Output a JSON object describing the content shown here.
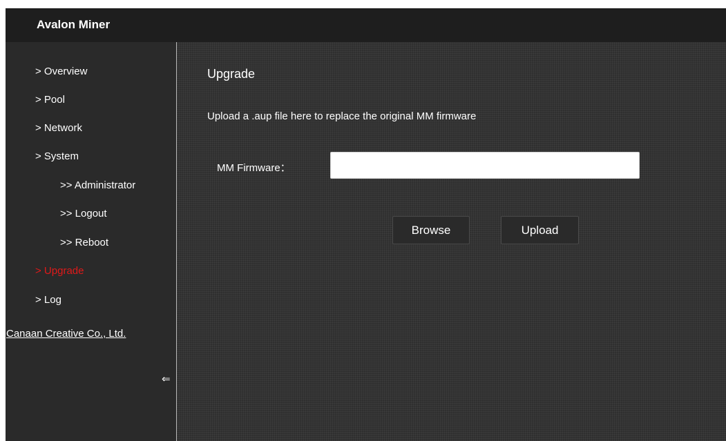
{
  "header": {
    "title": "Avalon Miner"
  },
  "sidebar": {
    "items": [
      {
        "label": "> Overview"
      },
      {
        "label": "> Pool"
      },
      {
        "label": "> Network"
      },
      {
        "label": "> System"
      },
      {
        "label": ">> Administrator"
      },
      {
        "label": ">> Logout"
      },
      {
        "label": ">> Reboot"
      },
      {
        "label": "> Upgrade",
        "active": true
      },
      {
        "label": "> Log"
      }
    ],
    "company_link": "Canaan Creative Co., Ltd.",
    "collapse_icon": "⇐"
  },
  "main": {
    "title": "Upgrade",
    "description": "Upload a .aup file here to replace the original MM firmware",
    "firmware_label": "MM Firmware：",
    "firmware_value": "",
    "browse_label": "Browse",
    "upload_label": "Upload"
  },
  "colors": {
    "active_nav": "#e01919",
    "background": "#2d2d2d",
    "header": "#1e1e1e"
  }
}
